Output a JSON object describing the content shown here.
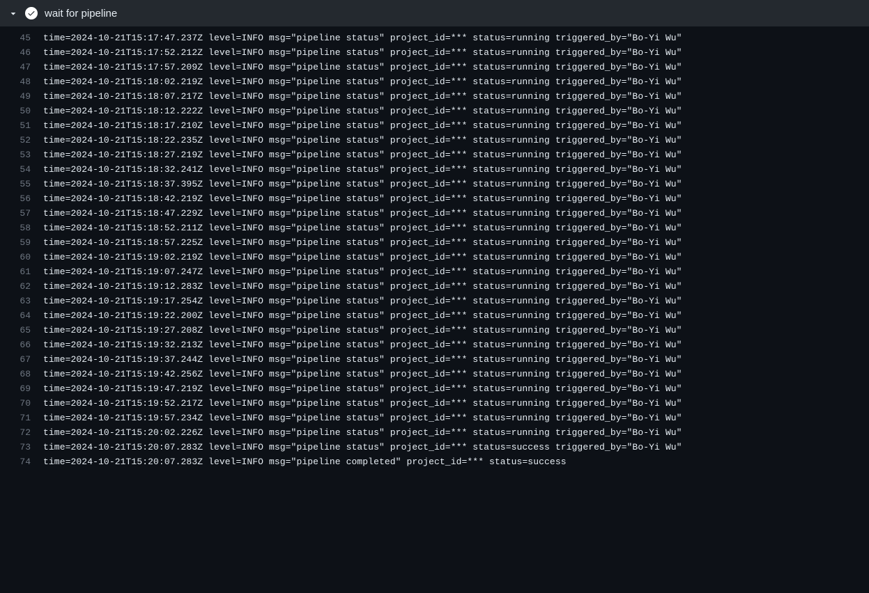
{
  "step": {
    "title": "wait for pipeline"
  },
  "log": {
    "lines": [
      {
        "num": "45",
        "text": "time=2024-10-21T15:17:47.237Z level=INFO msg=\"pipeline status\" project_id=*** status=running triggered_by=\"Bo-Yi Wu\""
      },
      {
        "num": "46",
        "text": "time=2024-10-21T15:17:52.212Z level=INFO msg=\"pipeline status\" project_id=*** status=running triggered_by=\"Bo-Yi Wu\""
      },
      {
        "num": "47",
        "text": "time=2024-10-21T15:17:57.209Z level=INFO msg=\"pipeline status\" project_id=*** status=running triggered_by=\"Bo-Yi Wu\""
      },
      {
        "num": "48",
        "text": "time=2024-10-21T15:18:02.219Z level=INFO msg=\"pipeline status\" project_id=*** status=running triggered_by=\"Bo-Yi Wu\""
      },
      {
        "num": "49",
        "text": "time=2024-10-21T15:18:07.217Z level=INFO msg=\"pipeline status\" project_id=*** status=running triggered_by=\"Bo-Yi Wu\""
      },
      {
        "num": "50",
        "text": "time=2024-10-21T15:18:12.222Z level=INFO msg=\"pipeline status\" project_id=*** status=running triggered_by=\"Bo-Yi Wu\""
      },
      {
        "num": "51",
        "text": "time=2024-10-21T15:18:17.210Z level=INFO msg=\"pipeline status\" project_id=*** status=running triggered_by=\"Bo-Yi Wu\""
      },
      {
        "num": "52",
        "text": "time=2024-10-21T15:18:22.235Z level=INFO msg=\"pipeline status\" project_id=*** status=running triggered_by=\"Bo-Yi Wu\""
      },
      {
        "num": "53",
        "text": "time=2024-10-21T15:18:27.219Z level=INFO msg=\"pipeline status\" project_id=*** status=running triggered_by=\"Bo-Yi Wu\""
      },
      {
        "num": "54",
        "text": "time=2024-10-21T15:18:32.241Z level=INFO msg=\"pipeline status\" project_id=*** status=running triggered_by=\"Bo-Yi Wu\""
      },
      {
        "num": "55",
        "text": "time=2024-10-21T15:18:37.395Z level=INFO msg=\"pipeline status\" project_id=*** status=running triggered_by=\"Bo-Yi Wu\""
      },
      {
        "num": "56",
        "text": "time=2024-10-21T15:18:42.219Z level=INFO msg=\"pipeline status\" project_id=*** status=running triggered_by=\"Bo-Yi Wu\""
      },
      {
        "num": "57",
        "text": "time=2024-10-21T15:18:47.229Z level=INFO msg=\"pipeline status\" project_id=*** status=running triggered_by=\"Bo-Yi Wu\""
      },
      {
        "num": "58",
        "text": "time=2024-10-21T15:18:52.211Z level=INFO msg=\"pipeline status\" project_id=*** status=running triggered_by=\"Bo-Yi Wu\""
      },
      {
        "num": "59",
        "text": "time=2024-10-21T15:18:57.225Z level=INFO msg=\"pipeline status\" project_id=*** status=running triggered_by=\"Bo-Yi Wu\""
      },
      {
        "num": "60",
        "text": "time=2024-10-21T15:19:02.219Z level=INFO msg=\"pipeline status\" project_id=*** status=running triggered_by=\"Bo-Yi Wu\""
      },
      {
        "num": "61",
        "text": "time=2024-10-21T15:19:07.247Z level=INFO msg=\"pipeline status\" project_id=*** status=running triggered_by=\"Bo-Yi Wu\""
      },
      {
        "num": "62",
        "text": "time=2024-10-21T15:19:12.283Z level=INFO msg=\"pipeline status\" project_id=*** status=running triggered_by=\"Bo-Yi Wu\""
      },
      {
        "num": "63",
        "text": "time=2024-10-21T15:19:17.254Z level=INFO msg=\"pipeline status\" project_id=*** status=running triggered_by=\"Bo-Yi Wu\""
      },
      {
        "num": "64",
        "text": "time=2024-10-21T15:19:22.200Z level=INFO msg=\"pipeline status\" project_id=*** status=running triggered_by=\"Bo-Yi Wu\""
      },
      {
        "num": "65",
        "text": "time=2024-10-21T15:19:27.208Z level=INFO msg=\"pipeline status\" project_id=*** status=running triggered_by=\"Bo-Yi Wu\""
      },
      {
        "num": "66",
        "text": "time=2024-10-21T15:19:32.213Z level=INFO msg=\"pipeline status\" project_id=*** status=running triggered_by=\"Bo-Yi Wu\""
      },
      {
        "num": "67",
        "text": "time=2024-10-21T15:19:37.244Z level=INFO msg=\"pipeline status\" project_id=*** status=running triggered_by=\"Bo-Yi Wu\""
      },
      {
        "num": "68",
        "text": "time=2024-10-21T15:19:42.256Z level=INFO msg=\"pipeline status\" project_id=*** status=running triggered_by=\"Bo-Yi Wu\""
      },
      {
        "num": "69",
        "text": "time=2024-10-21T15:19:47.219Z level=INFO msg=\"pipeline status\" project_id=*** status=running triggered_by=\"Bo-Yi Wu\""
      },
      {
        "num": "70",
        "text": "time=2024-10-21T15:19:52.217Z level=INFO msg=\"pipeline status\" project_id=*** status=running triggered_by=\"Bo-Yi Wu\""
      },
      {
        "num": "71",
        "text": "time=2024-10-21T15:19:57.234Z level=INFO msg=\"pipeline status\" project_id=*** status=running triggered_by=\"Bo-Yi Wu\""
      },
      {
        "num": "72",
        "text": "time=2024-10-21T15:20:02.226Z level=INFO msg=\"pipeline status\" project_id=*** status=running triggered_by=\"Bo-Yi Wu\""
      },
      {
        "num": "73",
        "text": "time=2024-10-21T15:20:07.283Z level=INFO msg=\"pipeline status\" project_id=*** status=success triggered_by=\"Bo-Yi Wu\""
      },
      {
        "num": "74",
        "text": "time=2024-10-21T15:20:07.283Z level=INFO msg=\"pipeline completed\" project_id=*** status=success"
      }
    ]
  }
}
